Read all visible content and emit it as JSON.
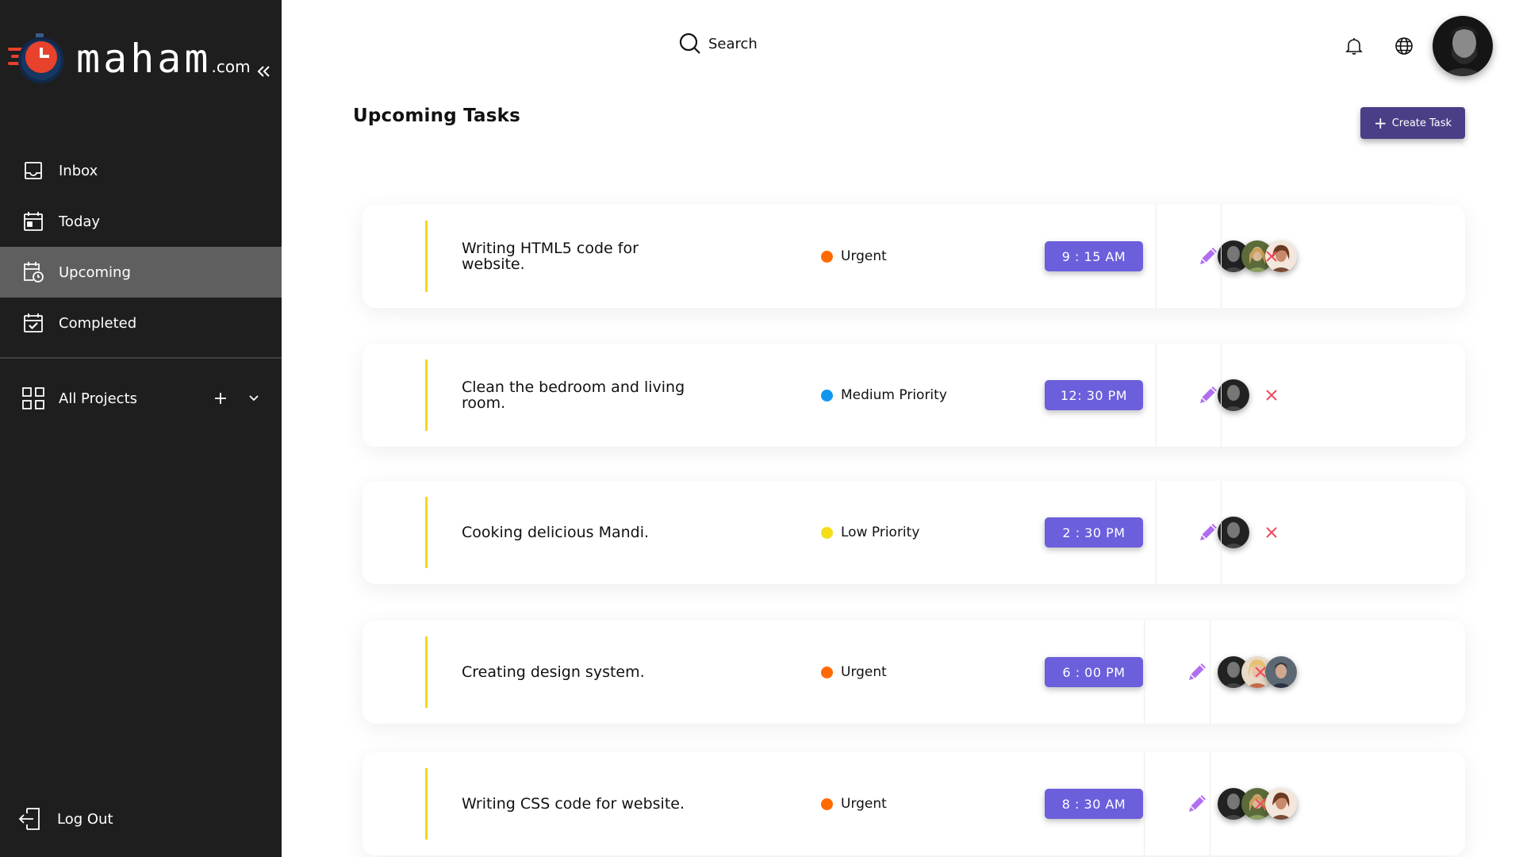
{
  "brand": {
    "name": "maham",
    "suffix": ".com",
    "accent": "#e8412c"
  },
  "nav": {
    "items": [
      {
        "label": "Inbox",
        "icon": "inbox-icon"
      },
      {
        "label": "Today",
        "icon": "calendar-icon"
      },
      {
        "label": "Upcoming",
        "icon": "calendar-clock-icon",
        "active": true
      },
      {
        "label": "Completed",
        "icon": "calendar-check-icon"
      }
    ],
    "projects_label": "All Projects",
    "logout_label": "Log Out"
  },
  "topbar": {
    "search_label": "Search"
  },
  "main": {
    "title": "Upcoming Tasks",
    "create_label": "Create Task"
  },
  "colors": {
    "urgent": "#ff6a00",
    "medium": "#1196ee",
    "low": "#f5de18",
    "time_badge": "#6c5fdc",
    "create_button": "#4a3f86",
    "edit": "#b06ef0",
    "delete": "#ef4a5e",
    "task_bar": "#f7d51d"
  },
  "tasks": [
    {
      "title": "Writing HTML5 code for website.",
      "priority": "Urgent",
      "time": "9 : 15 AM",
      "assignees": 3
    },
    {
      "title": "Clean the bedroom and living room.",
      "priority": "Medium Priority",
      "time": "12: 30 PM",
      "assignees": 1
    },
    {
      "title": "Cooking delicious Mandi.",
      "priority": "Low Priority",
      "time": "2 : 30 PM",
      "assignees": 1
    },
    {
      "title": "Creating design system.",
      "priority": "Urgent",
      "time": "6 : 00 PM",
      "assignees": 3
    },
    {
      "title": "Writing CSS code for website.",
      "priority": "Urgent",
      "time": "8 : 30 AM",
      "assignees": 3
    }
  ]
}
